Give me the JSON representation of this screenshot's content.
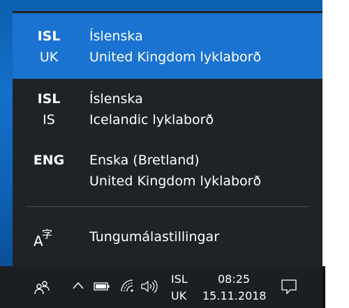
{
  "language_flyout": {
    "items": [
      {
        "code": "ISL",
        "region": "UK",
        "language": "Íslenska",
        "keyboard": "United Kingdom lyklaborð",
        "selected": true
      },
      {
        "code": "ISL",
        "region": "IS",
        "language": "Íslenska",
        "keyboard": "Icelandic lyklaborð",
        "selected": false
      },
      {
        "code": "ENG",
        "region": "",
        "language": "Enska (Bretland)",
        "keyboard": "United Kingdom lyklaborð",
        "selected": false
      }
    ],
    "settings_label": "Tungumálastillingar",
    "settings_icon": "language-settings-icon"
  },
  "taskbar": {
    "input_indicator": {
      "code": "ISL",
      "region": "UK"
    },
    "clock": {
      "time": "08:25",
      "date": "15.11.2018"
    },
    "icons": [
      "people-icon",
      "chevron-up-icon",
      "battery-icon",
      "wifi-icon",
      "volume-icon",
      "notification-icon"
    ]
  },
  "colors": {
    "flyout_background": "#1f2326",
    "selected_background": "#1a73d1",
    "taskbar_background": "#1b1f22",
    "text": "#ffffff"
  }
}
